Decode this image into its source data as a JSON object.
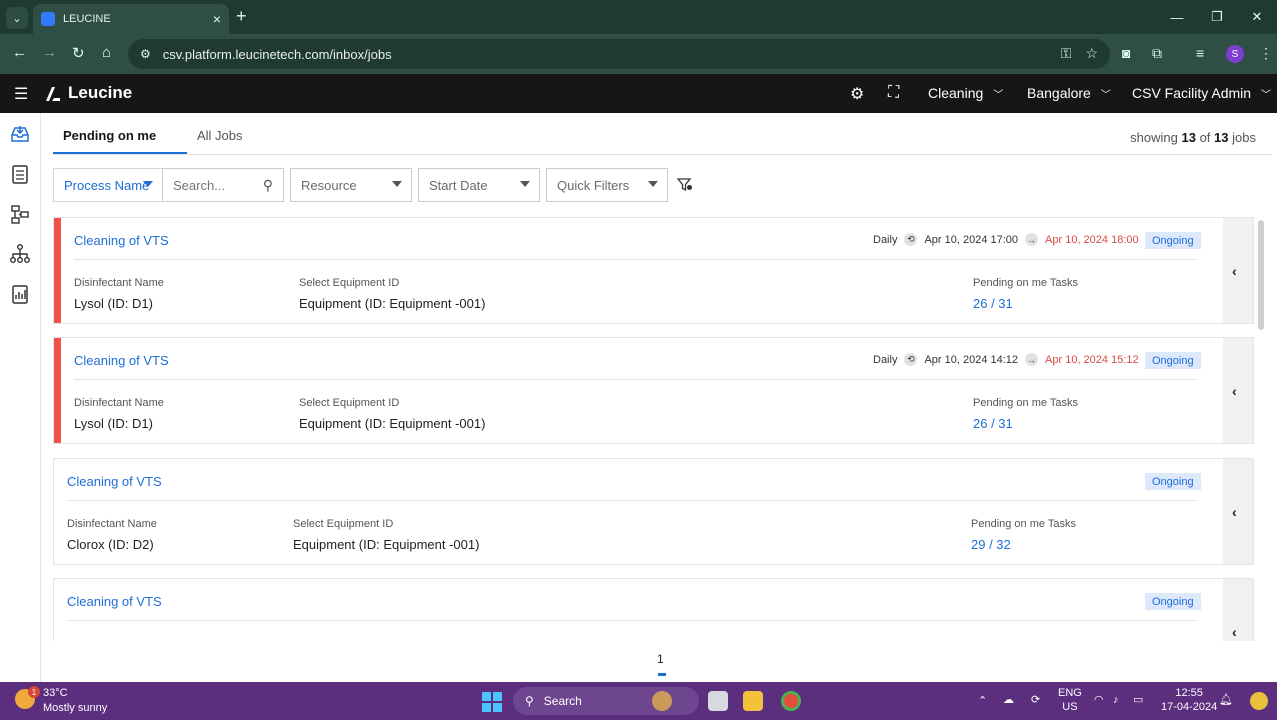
{
  "browser": {
    "tab_title": "LEUCINE",
    "url": "csv.platform.leucinetech.com/inbox/jobs",
    "profile_initial": "S"
  },
  "header": {
    "brand": "Leucine",
    "facility": "Cleaning",
    "location": "Bangalore",
    "user": "CSV Facility Admin"
  },
  "tabs": [
    {
      "label": "Pending on me"
    },
    {
      "label": "All Jobs"
    }
  ],
  "showing": {
    "prefix": "showing",
    "count": "13",
    "sep": "of",
    "total": "13",
    "suffix": "jobs"
  },
  "filters": {
    "process": "Process Name",
    "search_placeholder": "Search...",
    "resource": "Resource",
    "start_date": "Start Date",
    "quick": "Quick Filters"
  },
  "cards": [
    {
      "title": "Cleaning of VTS",
      "frequency": "Daily",
      "start": "Apr 10, 2024 17:00",
      "end": "Apr 10, 2024 18:00",
      "status": "Ongoing",
      "f1_label": "Disinfectant Name",
      "f1_value": "Lysol (ID: D1)",
      "f2_label": "Select Equipment ID",
      "f2_value": "Equipment (ID: Equipment -001)",
      "f3_label": "Pending on me Tasks",
      "f3_value": "26 / 31"
    },
    {
      "title": "Cleaning of VTS",
      "frequency": "Daily",
      "start": "Apr 10, 2024 14:12",
      "end": "Apr 10, 2024 15:12",
      "status": "Ongoing",
      "f1_label": "Disinfectant Name",
      "f1_value": "Lysol (ID: D1)",
      "f2_label": "Select Equipment ID",
      "f2_value": "Equipment (ID: Equipment -001)",
      "f3_label": "Pending on me Tasks",
      "f3_value": "26 / 31"
    },
    {
      "title": "Cleaning of VTS",
      "status": "Ongoing",
      "f1_label": "Disinfectant Name",
      "f1_value": "Clorox (ID: D2)",
      "f2_label": "Select Equipment ID",
      "f2_value": "Equipment (ID: Equipment -001)",
      "f3_label": "Pending on me Tasks",
      "f3_value": "29 / 32"
    },
    {
      "title": "Cleaning of VTS",
      "status": "Ongoing"
    }
  ],
  "pagination": {
    "current": "1"
  },
  "taskbar": {
    "temperature": "33°C",
    "condition": "Mostly sunny",
    "weather_badge": "1",
    "search": "Search",
    "lang": "ENG",
    "region": "US",
    "time": "12:55",
    "date": "17-04-2024"
  },
  "colors": {
    "accent": "#1d6ed6",
    "overdue": "#f0524b",
    "header_bg": "#161616",
    "taskbar_bg": "#5b2e7e"
  }
}
